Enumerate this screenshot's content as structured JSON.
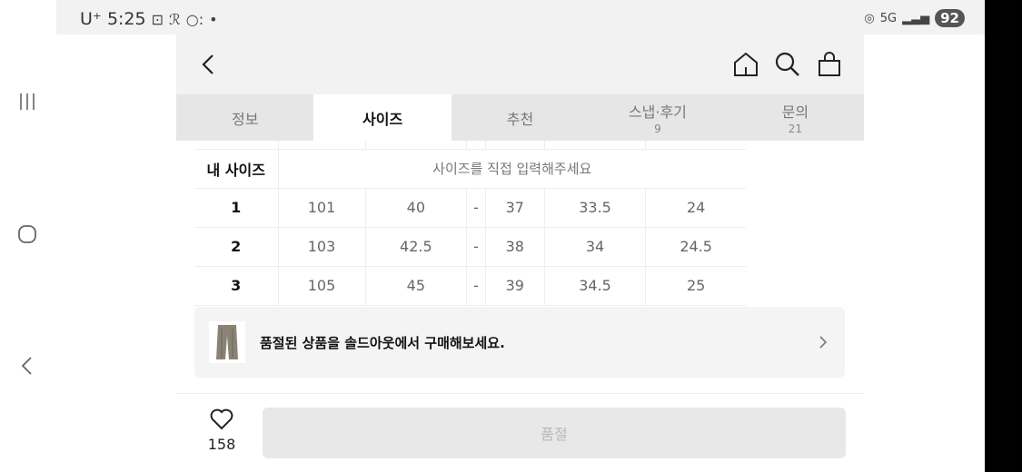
{
  "status_bar": {
    "carrier": "U⁺",
    "time": "5:25",
    "battery": "92",
    "network": "5G"
  },
  "tabs": [
    {
      "label": "정보",
      "count": ""
    },
    {
      "label": "사이즈",
      "count": ""
    },
    {
      "label": "추천",
      "count": ""
    },
    {
      "label": "스냅·후기",
      "count": "9"
    },
    {
      "label": "문의",
      "count": "21"
    }
  ],
  "active_tab": "사이즈",
  "size_table": {
    "my_size_label": "내 사이즈",
    "my_size_hint": "사이즈를 직접 입력해주세요",
    "rows": [
      {
        "size": "1",
        "values": [
          "101",
          "40",
          "-",
          "37",
          "33.5",
          "24"
        ]
      },
      {
        "size": "2",
        "values": [
          "103",
          "42.5",
          "-",
          "38",
          "34",
          "24.5"
        ]
      },
      {
        "size": "3",
        "values": [
          "105",
          "45",
          "-",
          "39",
          "34.5",
          "25"
        ]
      }
    ]
  },
  "banner": {
    "text": "품절된 상품을 솔드아웃에서 구매해보세요."
  },
  "bottom_bar": {
    "like_count": "158",
    "button_label": "품절"
  },
  "icons": [
    "back-arrow-icon",
    "home-icon",
    "search-icon",
    "shopping-bag-icon",
    "heart-icon",
    "chevron-right-icon",
    "recents-icon",
    "home-circle-icon",
    "android-back-icon"
  ]
}
